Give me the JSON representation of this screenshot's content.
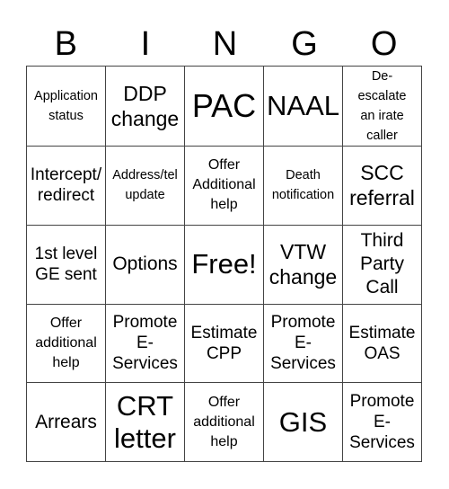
{
  "header": {
    "letters": [
      "B",
      "I",
      "N",
      "G",
      "O"
    ]
  },
  "card": {
    "rows": [
      [
        "Application\nstatus",
        "DDP\nchange",
        "PAC",
        "NAAL",
        "De-\nescalate\nan irate\ncaller"
      ],
      [
        "Intercept/\nredirect",
        "Address/tel\nupdate",
        "Offer\nAdditional\nhelp",
        "Death\nnotification",
        "SCC\nreferral"
      ],
      [
        "1st level\nGE sent",
        "Options",
        "Free!",
        "VTW\nchange",
        "Third\nParty\nCall"
      ],
      [
        "Offer\nadditional\nhelp",
        "Promote\nE-\nServices",
        "Estimate\nCPP",
        "Promote\nE-\nServices",
        "Estimate\nOAS"
      ],
      [
        "Arrears",
        "CRT\nletter",
        "Offer\nadditional\nhelp",
        "GIS",
        "Promote\nE-\nServices"
      ]
    ]
  }
}
